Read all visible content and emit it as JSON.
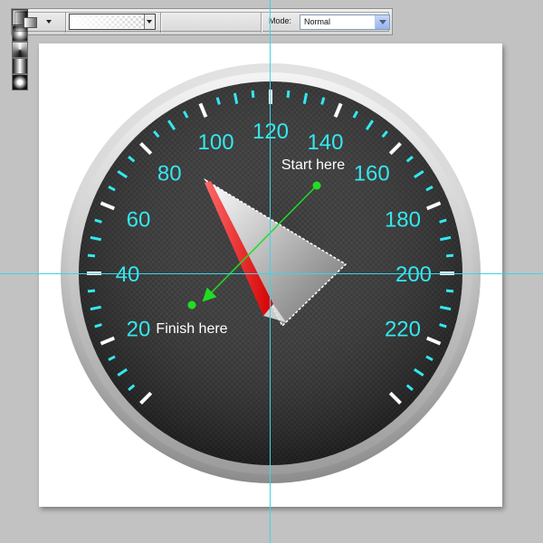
{
  "toolbar": {
    "tool_preset_icon": "gradient-tool-icon",
    "gradient_types": [
      {
        "name": "linear-gradient-icon",
        "active": true
      },
      {
        "name": "radial-gradient-icon",
        "active": false
      },
      {
        "name": "angle-gradient-icon",
        "active": false
      },
      {
        "name": "reflected-gradient-icon",
        "active": false
      },
      {
        "name": "diamond-gradient-icon",
        "active": false
      }
    ],
    "mode_label": "Mode:",
    "mode_value": "Normal"
  },
  "gauge": {
    "scale_labels": [
      "20",
      "40",
      "60",
      "80",
      "100",
      "120",
      "140",
      "160",
      "180",
      "200",
      "220"
    ],
    "colors": {
      "accent": "#33e8f0",
      "face": "#2a2a2a",
      "needle": "#ff2a2a",
      "guide": "#36d8e8",
      "drag_line": "#22dd22"
    }
  },
  "annotations": {
    "start_label": "Start here",
    "finish_label": "Finish here"
  }
}
